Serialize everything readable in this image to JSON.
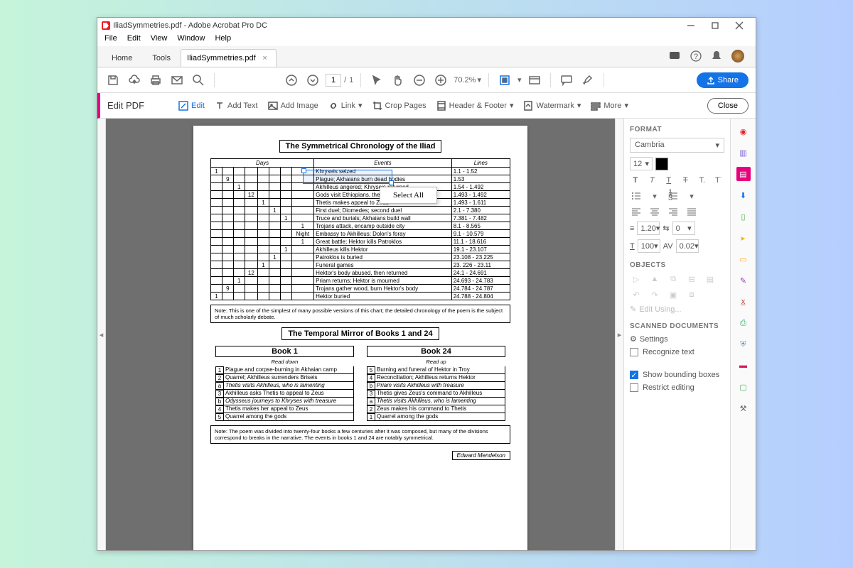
{
  "titlebar": {
    "title": "IliadSymmetries.pdf - Adobe Acrobat Pro DC"
  },
  "menu": [
    "File",
    "Edit",
    "View",
    "Window",
    "Help"
  ],
  "tabs": {
    "home": "Home",
    "tools": "Tools",
    "doc": "IliadSymmetries.pdf"
  },
  "toolbar": {
    "page": "1",
    "pages": "1",
    "zoom": "70.2%"
  },
  "share": "Share",
  "editbar": {
    "title": "Edit PDF",
    "edit": "Edit",
    "addtext": "Add Text",
    "addimage": "Add Image",
    "link": "Link",
    "crop": "Crop Pages",
    "header": "Header & Footer",
    "watermark": "Watermark",
    "more": "More",
    "close": "Close"
  },
  "ctxmenu": "Select All",
  "format": {
    "hdr": "FORMAT",
    "font": "Cambria",
    "size": "12",
    "lh": "1.20",
    "ls": "0",
    "sc": "100",
    "av": "0.02"
  },
  "objects": {
    "hdr": "OBJECTS",
    "editusing": "Edit Using..."
  },
  "scanned": {
    "hdr": "SCANNED DOCUMENTS",
    "settings": "Settings",
    "recog": "Recognize text",
    "showbb": "Show bounding boxes",
    "restrict": "Restrict editing"
  },
  "doc": {
    "title": "The Symmetrical Chronology of the Iliad",
    "th": [
      "Days",
      "Events",
      "Lines"
    ],
    "rows": [
      {
        "d": [
          "1",
          "",
          "",
          "",
          "",
          "",
          "",
          ""
        ],
        "e": "Khryseis seized",
        "l": "1.1 - 1.52"
      },
      {
        "d": [
          "",
          "9",
          "",
          "",
          "",
          "",
          "",
          ""
        ],
        "e": "Plague; Akhaians burn dead bodies",
        "l": "1.53"
      },
      {
        "d": [
          "",
          "",
          "1",
          "",
          "",
          "",
          "",
          ""
        ],
        "e": "Akhilleus angered; Khryseis returned",
        "l": "1.54 - 1.492"
      },
      {
        "d": [
          "",
          "",
          "",
          "12",
          "",
          "",
          "",
          ""
        ],
        "e": "Gods visit Ethiopians, then return",
        "l": "1.493 - 1.492"
      },
      {
        "d": [
          "",
          "",
          "",
          "",
          "1",
          "",
          "",
          ""
        ],
        "e": "Thetis makes appeal to Zeus",
        "l": "1.493 - 1.611"
      },
      {
        "d": [
          "",
          "",
          "",
          "",
          "",
          "1",
          "",
          ""
        ],
        "e": "First duel; Diomedes; second duel",
        "l": "2.1 - 7.380"
      },
      {
        "d": [
          "",
          "",
          "",
          "",
          "",
          "",
          "1",
          ""
        ],
        "e": "Truce and burials; Akhaians build wall",
        "l": "7.381 - 7.482"
      },
      {
        "d": [
          "",
          "",
          "",
          "",
          "",
          "",
          "",
          "1"
        ],
        "e": "Trojans attack, encamp outside city",
        "l": "8.1 - 8.565"
      },
      {
        "d": [
          "",
          "",
          "",
          "",
          "",
          "",
          "",
          "Night"
        ],
        "e": "Embassy to Akhilleus; Dolon's foray",
        "l": "9.1 - 10.579"
      },
      {
        "d": [
          "",
          "",
          "",
          "",
          "",
          "",
          "",
          "1"
        ],
        "e": "Great battle; Hektor kills Patroklos",
        "l": "11.1 - 18.616"
      },
      {
        "d": [
          "",
          "",
          "",
          "",
          "",
          "",
          "1",
          ""
        ],
        "e": "Akhilleus kills Hektor",
        "l": "19.1 - 23.107"
      },
      {
        "d": [
          "",
          "",
          "",
          "",
          "",
          "1",
          "",
          ""
        ],
        "e": "Patroklos is buried",
        "l": "23.108 - 23.225"
      },
      {
        "d": [
          "",
          "",
          "",
          "",
          "1",
          "",
          "",
          ""
        ],
        "e": "Funeral games",
        "l": "23. 226 - 23.11"
      },
      {
        "d": [
          "",
          "",
          "",
          "12",
          "",
          "",
          "",
          ""
        ],
        "e": "Hektor's body abused, then returned",
        "l": "24.1 - 24.691"
      },
      {
        "d": [
          "",
          "",
          "1",
          "",
          "",
          "",
          "",
          ""
        ],
        "e": "Priam returns; Hektor is mourned",
        "l": "24.693 - 24.783"
      },
      {
        "d": [
          "",
          "9",
          "",
          "",
          "",
          "",
          "",
          ""
        ],
        "e": "Trojans gather wood, burn Hektor's body",
        "l": "24.784 - 24.787"
      },
      {
        "d": [
          "1",
          "",
          "",
          "",
          "",
          "",
          "",
          ""
        ],
        "e": "Hektor buried",
        "l": "24.788 - 24.804"
      }
    ],
    "note1": "Note: This is one of the simplest of many possible versions of this chart; the detailed chronology of the poem is the subject of much scholarly debate.",
    "mirror_title": "The Temporal Mirror of Books 1 and 24",
    "b1": {
      "h": "Book 1",
      "s": "Read down",
      "rows": [
        {
          "n": "1",
          "t": "Plague and corpse-burning in Akhaian camp"
        },
        {
          "n": "2",
          "t": "Quarrel; Akhilleus surrenders Briseis"
        },
        {
          "n": "a",
          "t": "Thetis visits Akhilleus, who is lamenting",
          "it": true
        },
        {
          "n": "3",
          "t": "Akhilleus asks Thetis to appeal to Zeus"
        },
        {
          "n": "b",
          "t": "Odysseus journeys to Khryses with treasure",
          "it": true
        },
        {
          "n": "4",
          "t": "Thetis makes her appeal to Zeus"
        },
        {
          "n": "5",
          "t": "Quarrel among the gods"
        }
      ]
    },
    "b24": {
      "h": "Book 24",
      "s": "Read up",
      "rows": [
        {
          "n": "5",
          "t": "Burning and funeral of Hektor in Troy"
        },
        {
          "n": "4",
          "t": "Reconciliation; Akhilleus returns Hektor"
        },
        {
          "n": "b",
          "t": "Priam visits Akhilleus with treasure",
          "it": true
        },
        {
          "n": "3",
          "t": "Thetis gives Zeus's command to Akhilleus"
        },
        {
          "n": "a",
          "t": "Thetis visits Akhilleus, who is lamenting",
          "it": true
        },
        {
          "n": "2",
          "t": "Zeus makes his command to Thetis"
        },
        {
          "n": "1",
          "t": "Quarrel among the gods"
        }
      ]
    },
    "note2": "Note: The poem was divided into twenty-four books a few centuries after it was composed, but many of the divisions correspond to breaks in the narrative. The events in books 1 and 24 are notably symmetrical.",
    "author": "Edward Mendelson"
  }
}
